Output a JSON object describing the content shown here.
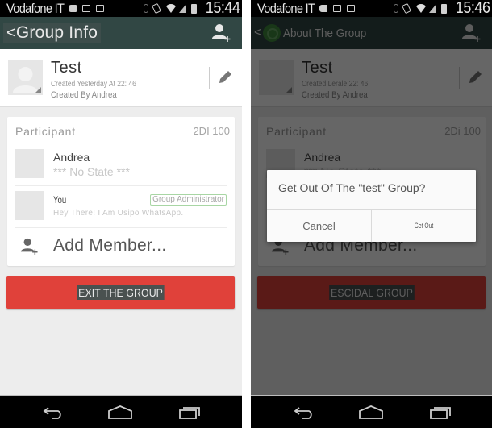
{
  "left": {
    "status_bar": {
      "carrier": "Vodafone IT",
      "time": "15:44"
    },
    "action_bar": {
      "back": "<",
      "title": "Group Info",
      "add_participant_icon": "add-person-icon"
    },
    "group": {
      "name": "Test",
      "created": "Created Yesterday At 22: 46",
      "created_by": "Created By Andrea",
      "edit_icon": "pencil-icon"
    },
    "participants": {
      "title": "Participant",
      "count": "2DI 100",
      "members": [
        {
          "name": "Andrea",
          "status": "*** No State ***",
          "badge": ""
        },
        {
          "name": "You",
          "status": "Hey There! I Am Usipo WhatsApp.",
          "badge": "Group Administrator"
        }
      ],
      "add_member": "Add Member..."
    },
    "exit_button": "EXIT THE GROUP"
  },
  "right": {
    "status_bar": {
      "carrier": "Vodafone IT",
      "time": "15:46"
    },
    "action_bar": {
      "back": "<",
      "title": "About The Group"
    },
    "group": {
      "name": "Test",
      "created": "Created Lerale 22: 46",
      "created_by": "Created By Andrea"
    },
    "participants": {
      "title": "Participant",
      "count": "2Di 100",
      "members": [
        {
          "name": "Andrea",
          "status": "*** No State ***"
        }
      ],
      "add_member": "Add Member..."
    },
    "exit_button": "ESCIDAL GROUP",
    "dialog": {
      "message": "Get Out Of The \"test\" Group?",
      "cancel": "Cancel",
      "confirm": "Get Out"
    }
  },
  "nav_bar": {
    "back": "back-icon",
    "home": "home-icon",
    "recents": "recents-icon"
  },
  "colors": {
    "action_bar": "#314744",
    "exit_button": "#e0413a",
    "background": "#ededed",
    "admin_badge_border": "#a8d6a4",
    "whatsapp_green": "#3f8a3c"
  }
}
